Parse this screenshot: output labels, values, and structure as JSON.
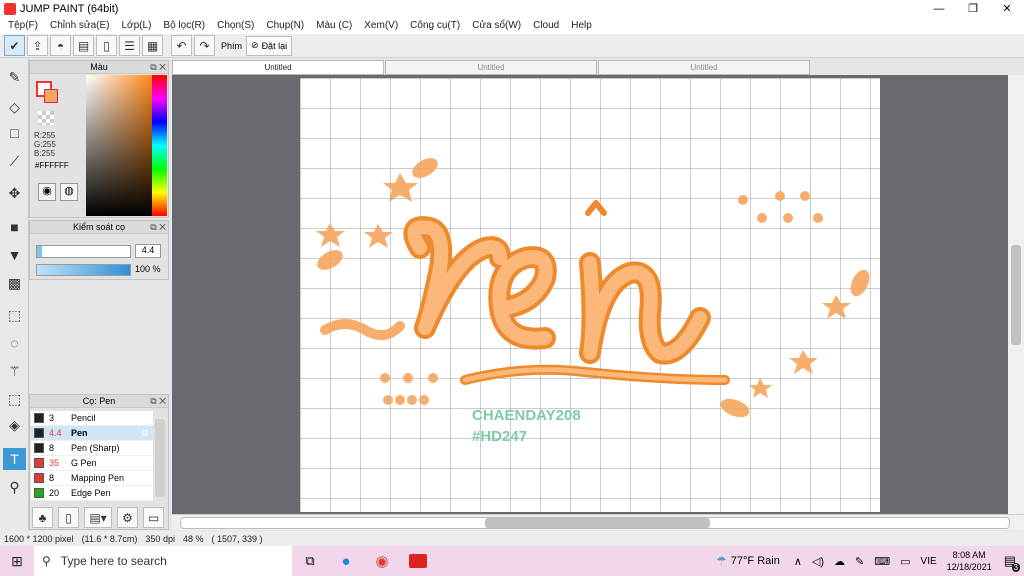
{
  "window": {
    "title": "JUMP PAINT (64bit)"
  },
  "menu": [
    "Tệp(F)",
    "Chỉnh sửa(E)",
    "Lớp(L)",
    "Bộ lọc(R)",
    "Chọn(S)",
    "Chụp(N)",
    "Màu (C)",
    "Xem(V)",
    "Công cụ(T)",
    "Cửa sổ(W)",
    "Cloud",
    "Help"
  ],
  "toolbar": {
    "phim_label": "Phím",
    "reset_label": "Đặt lại"
  },
  "color_panel": {
    "title": "Màu",
    "r": "R:255",
    "g": "G:255",
    "b": "B:255",
    "hex": "#FFFFFF"
  },
  "control_panel": {
    "title": "Kiểm soát cọ",
    "size_value": "4.4",
    "opacity_value": "100 %"
  },
  "brush_panel": {
    "title": "Cọ: Pen",
    "items": [
      {
        "size": "3",
        "name": "Pencil",
        "color": "#222222"
      },
      {
        "size": "4.4",
        "name": "Pen",
        "color": "#222222"
      },
      {
        "size": "8",
        "name": "Pen (Sharp)",
        "color": "#222222"
      },
      {
        "size": "35",
        "name": "G Pen",
        "color": "#e53935"
      },
      {
        "size": "8",
        "name": "Mapping Pen",
        "color": "#e53935"
      },
      {
        "size": "20",
        "name": "Edge Pen",
        "color": "#22aa22"
      }
    ]
  },
  "tabs": [
    "Untitled",
    "Untitled",
    "Untitled"
  ],
  "canvas_text": {
    "title": "rẻn",
    "credit1": "CHAENDAY208",
    "credit2": "#HD247"
  },
  "status": {
    "pixels": "1600 * 1200 pixel",
    "size": "(11.6 * 8.7cm)",
    "dpi": "350 dpi",
    "zoom": "48 %",
    "coords": "( 1507, 339 )"
  },
  "taskbar": {
    "search_placeholder": "Type here to search",
    "weather": "77°F Rain",
    "lang": "VIE",
    "time": "8:08 AM",
    "date": "12/18/2021",
    "notif_count": "3"
  },
  "colors": {
    "accent": "#3d98d6",
    "orange": "#f7a65e",
    "orange_dark": "#ee8a2c",
    "credit": "#7fc9a3"
  }
}
